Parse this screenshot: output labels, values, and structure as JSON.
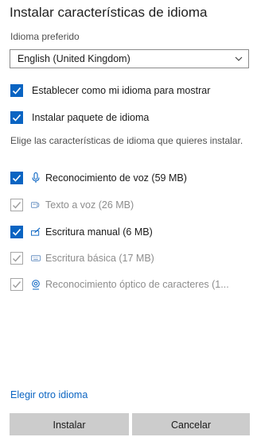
{
  "window": {
    "title": "Instalar características de idioma"
  },
  "preferred": {
    "label": "Idioma preferido",
    "selected": "English (United Kingdom)"
  },
  "options": [
    {
      "label": "Establecer como mi idioma para mostrar",
      "checked": true
    },
    {
      "label": "Instalar paquete de idioma",
      "checked": true
    }
  ],
  "features_description": "Elige las características de idioma que quieres instalar.",
  "features": [
    {
      "label": "Reconocimiento de voz (59 MB)",
      "checked": true,
      "enabled": true,
      "icon": "microphone-icon"
    },
    {
      "label": "Texto a voz (26 MB)",
      "checked": true,
      "enabled": false,
      "icon": "text-to-speech-icon"
    },
    {
      "label": "Escritura manual (6 MB)",
      "checked": true,
      "enabled": true,
      "icon": "handwriting-icon"
    },
    {
      "label": "Escritura básica (17 MB)",
      "checked": true,
      "enabled": false,
      "icon": "keyboard-icon"
    },
    {
      "label": "Reconocimiento óptico de caracteres (1...",
      "checked": true,
      "enabled": false,
      "icon": "ocr-icon"
    }
  ],
  "link": {
    "label": "Elegir otro idioma"
  },
  "buttons": {
    "install": "Instalar",
    "cancel": "Cancelar"
  },
  "colors": {
    "accent": "#0a64c2",
    "muted_check": "#9b9b9b",
    "button_bg": "#cccccc"
  }
}
